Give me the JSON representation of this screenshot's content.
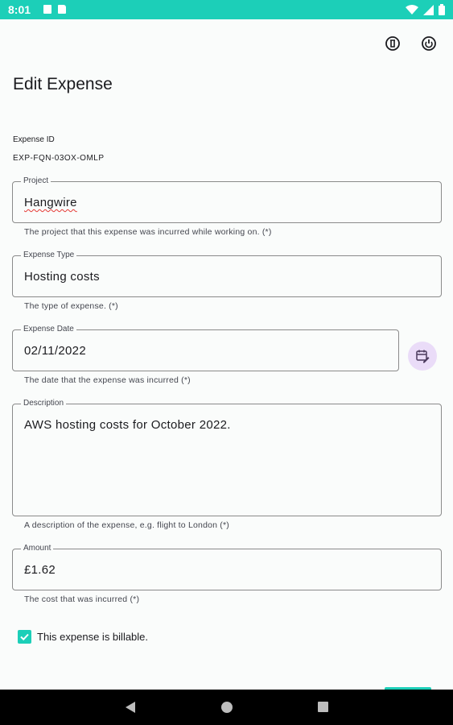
{
  "status_bar": {
    "time": "8:01",
    "icons": [
      "notification-icon",
      "sd-card-icon",
      "wifi-icon",
      "signal-icon",
      "battery-icon"
    ]
  },
  "app_bar": {
    "actions": [
      "delete-icon",
      "power-icon"
    ]
  },
  "page": {
    "title": "Edit Expense"
  },
  "expense_id": {
    "label": "Expense ID",
    "value": "EXP-FQN-03OX-OMLP"
  },
  "fields": {
    "project": {
      "label": "Project",
      "value": "Hangwire",
      "helper": "The project that this expense was incurred while working on. (*)"
    },
    "expense_type": {
      "label": "Expense Type",
      "value": "Hosting costs",
      "helper": "The type of expense. (*)"
    },
    "expense_date": {
      "label": "Expense Date",
      "value": "02/11/2022",
      "helper": "The date that the expense was incurred (*)"
    },
    "description": {
      "label": "Description",
      "value": "AWS hosting costs for October 2022.",
      "helper": "A description of the expense, e.g. flight to London (*)"
    },
    "amount": {
      "label": "Amount",
      "value": "£1.62",
      "helper": "The cost that was incurred (*)"
    }
  },
  "billable": {
    "label": "This expense is billable.",
    "checked": true
  },
  "colors": {
    "accent": "#1ccfb8",
    "calendar_button": "#eadcf8",
    "spell_error": "#e53935"
  }
}
